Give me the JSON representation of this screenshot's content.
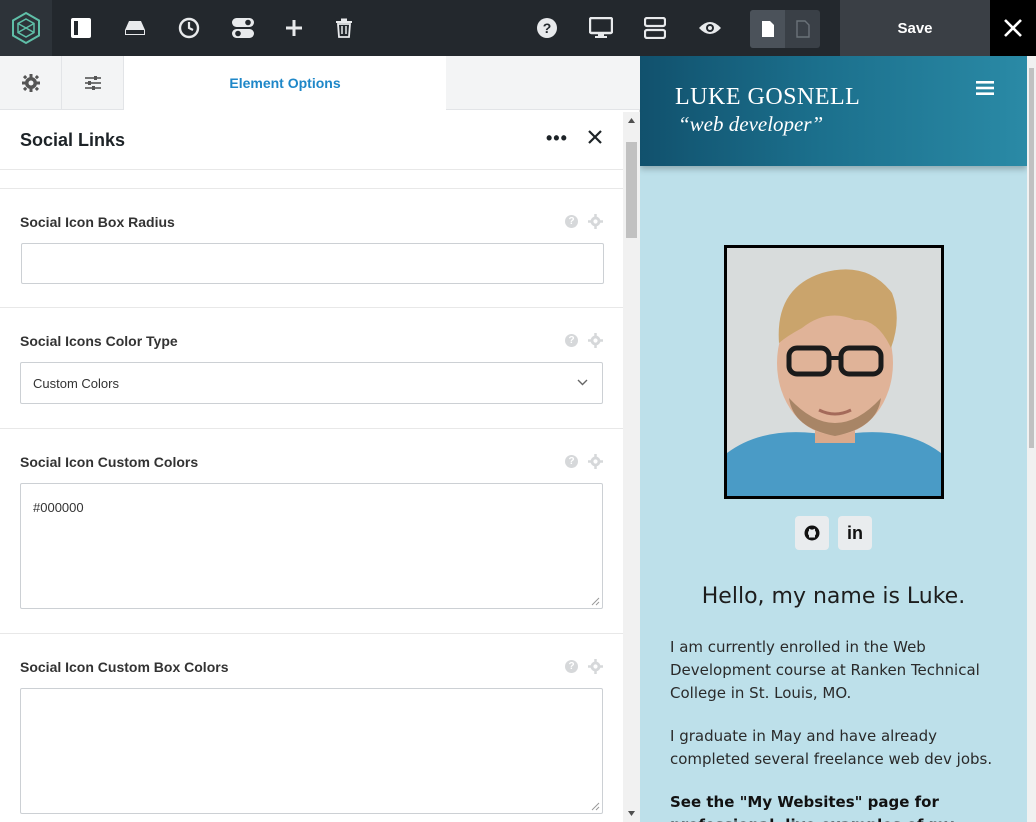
{
  "toolbar": {
    "save_label": "Save",
    "icons": [
      "layout-icon",
      "drive-icon",
      "history-icon",
      "toggle-icon",
      "plus-icon",
      "trash-icon",
      "help-icon",
      "desktop-icon",
      "rows-icon",
      "eye-icon",
      "page-icon"
    ]
  },
  "panel": {
    "tab_title": "Element Options",
    "element_title": "Social Links",
    "more_label": "•••",
    "options": [
      {
        "label": "Social Icon Box Radius",
        "value": ""
      },
      {
        "label": "Social Icons Color Type",
        "value": "Custom Colors"
      },
      {
        "label": "Social Icon Custom Colors",
        "value": "#000000"
      },
      {
        "label": "Social Icon Custom Box Colors",
        "value": ""
      }
    ],
    "help_glyph": "?"
  },
  "preview": {
    "site_name": "LUKE GOSNELL",
    "site_tagline": "“web developer”",
    "hello": "Hello, my name is Luke.",
    "para1": "I am currently enrolled in the Web Development course at Ranken Technical College in St. Louis, MO.",
    "para2": "I graduate in May and have already completed several freelance web dev jobs.",
    "para3": "See the \"My Websites\" page for professional, live examples of my freelance and personal",
    "social_icons": [
      "github-icon",
      "linkedin-icon"
    ],
    "linkedin_text": "in"
  },
  "colors": {
    "toolbar_bg": "#23282d",
    "accent": "#1e87c8",
    "preview_bg": "#bde0ea",
    "header_grad_start": "#11516d",
    "header_grad_end": "#2a8aa6"
  }
}
